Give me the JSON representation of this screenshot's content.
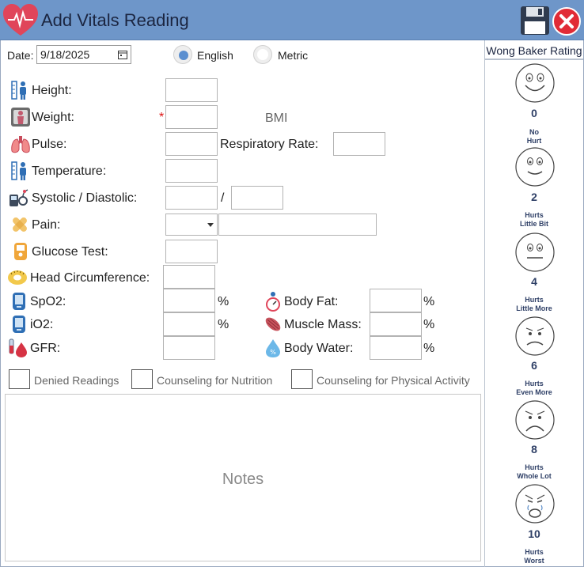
{
  "window": {
    "title": "Add Vitals Reading"
  },
  "date": {
    "label": "Date:",
    "value": "9/18/2025"
  },
  "units": {
    "english_label": "English",
    "metric_label": "Metric",
    "selected": "English"
  },
  "vitals": {
    "height_label": "Height:",
    "weight_label": "Weight:",
    "weight_required": "*",
    "bmi_label": "BMI",
    "pulse_label": "Pulse:",
    "respiratory_label": "Respiratory Rate:",
    "temperature_label": "Temperature:",
    "bp_label": "Systolic / Diastolic:",
    "bp_separator": "/",
    "pain_label": "Pain:",
    "glucose_label": "Glucose Test:",
    "head_label": "Head Circumference:",
    "spo2_label": "SpO2:",
    "io2_label": "iO2:",
    "gfr_label": "GFR:",
    "body_fat_label": "Body Fat:",
    "muscle_mass_label": "Muscle Mass:",
    "body_water_label": "Body Water:",
    "percent": "%"
  },
  "checkboxes": {
    "denied": "Denied Readings",
    "nutrition": "Counseling for Nutrition",
    "physical": "Counseling for Physical Activity"
  },
  "notes": {
    "placeholder": "Notes"
  },
  "wong_baker": {
    "title": "Wong Baker Rating",
    "faces": [
      {
        "value": "0",
        "line1": "No",
        "line2": "Hurt"
      },
      {
        "value": "2",
        "line1": "Hurts",
        "line2": "Little Bit"
      },
      {
        "value": "4",
        "line1": "Hurts",
        "line2": "Little More"
      },
      {
        "value": "6",
        "line1": "Hurts",
        "line2": "Even More"
      },
      {
        "value": "8",
        "line1": "Hurts",
        "line2": "Whole Lot"
      },
      {
        "value": "10",
        "line1": "Hurts",
        "line2": "Worst"
      }
    ]
  },
  "colors": {
    "titlebar": "#6e96c9",
    "radio_selected": "#5b8fd0",
    "required": "#dd1111",
    "face_text": "#2e3f66"
  },
  "icons": {
    "app": "heart-pulse-icon",
    "save": "floppy-disk-icon",
    "close": "close-circle-icon"
  }
}
